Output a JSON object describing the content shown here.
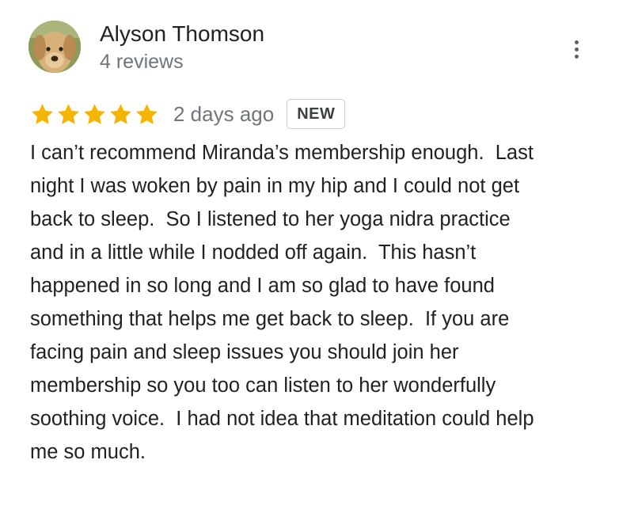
{
  "reviewer": {
    "name": "Alyson Thomson",
    "review_count": "4 reviews",
    "avatar_icon": "dog-avatar-icon"
  },
  "rating": {
    "stars": 5,
    "max_stars": 5,
    "star_color": "#f4b400",
    "date": "2 days ago",
    "badge": "NEW"
  },
  "menu": {
    "icon": "more-vertical-icon"
  },
  "review": {
    "text": "I can’t recommend Miranda’s membership enough.  Last\nnight I was woken by pain in my hip and I could not get\nback to sleep.  So I listened to her yoga nidra practice\nand in a little while I nodded off again.  This hasn’t\nhappened in so long and I am so glad to have found\nsomething that helps me get back to sleep.  If you are\nfacing pain and sleep issues you should join her\nmembership so you too can listen to her wonderfully\nsoothing voice.  I had not idea that meditation could help\nme so much."
  }
}
